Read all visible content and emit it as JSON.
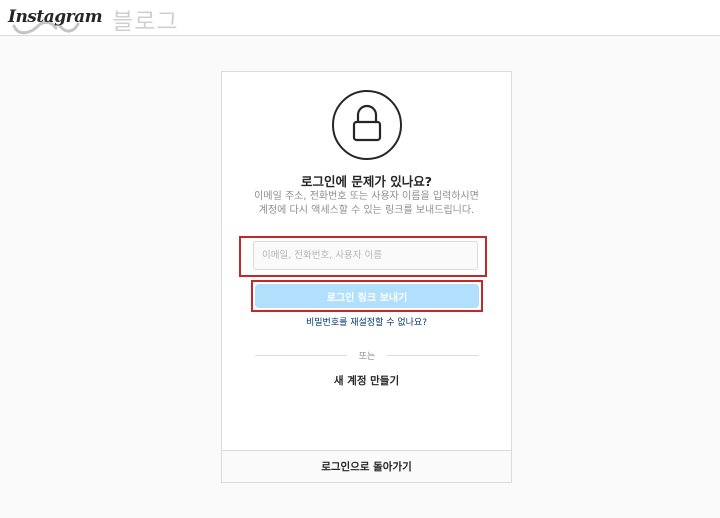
{
  "header": {
    "logo_text": "Instagram",
    "blog_text": "블로그",
    "logo_icon": "instagram-wordmark"
  },
  "recovery": {
    "lock_icon": "lock-icon",
    "title": "로그인에 문제가 있나요?",
    "description": "이메일 주소, 전화번호 또는 사용자 이름을 입력하시면 계정에 다시 액세스할 수 있는 링크를 보내드립니다.",
    "input_placeholder": "이메일, 전화번호, 사용자 이름",
    "input_value": "",
    "send_button_label": "로그인 링크 보내기",
    "reset_link_label": "비밀번호를 재설정할 수 없나요?",
    "divider_label": "또는",
    "create_account_label": "새 계정 만들기",
    "back_to_login_label": "로그인으로 돌아가기"
  },
  "colors": {
    "page_background": "#fafafa",
    "card_background": "#ffffff",
    "border": "#dbdbdb",
    "text_primary": "#262626",
    "text_secondary": "#8e8e8e",
    "button_disabled": "#b2dffc",
    "link": "#00376b",
    "highlight_outline": "#c62828"
  }
}
